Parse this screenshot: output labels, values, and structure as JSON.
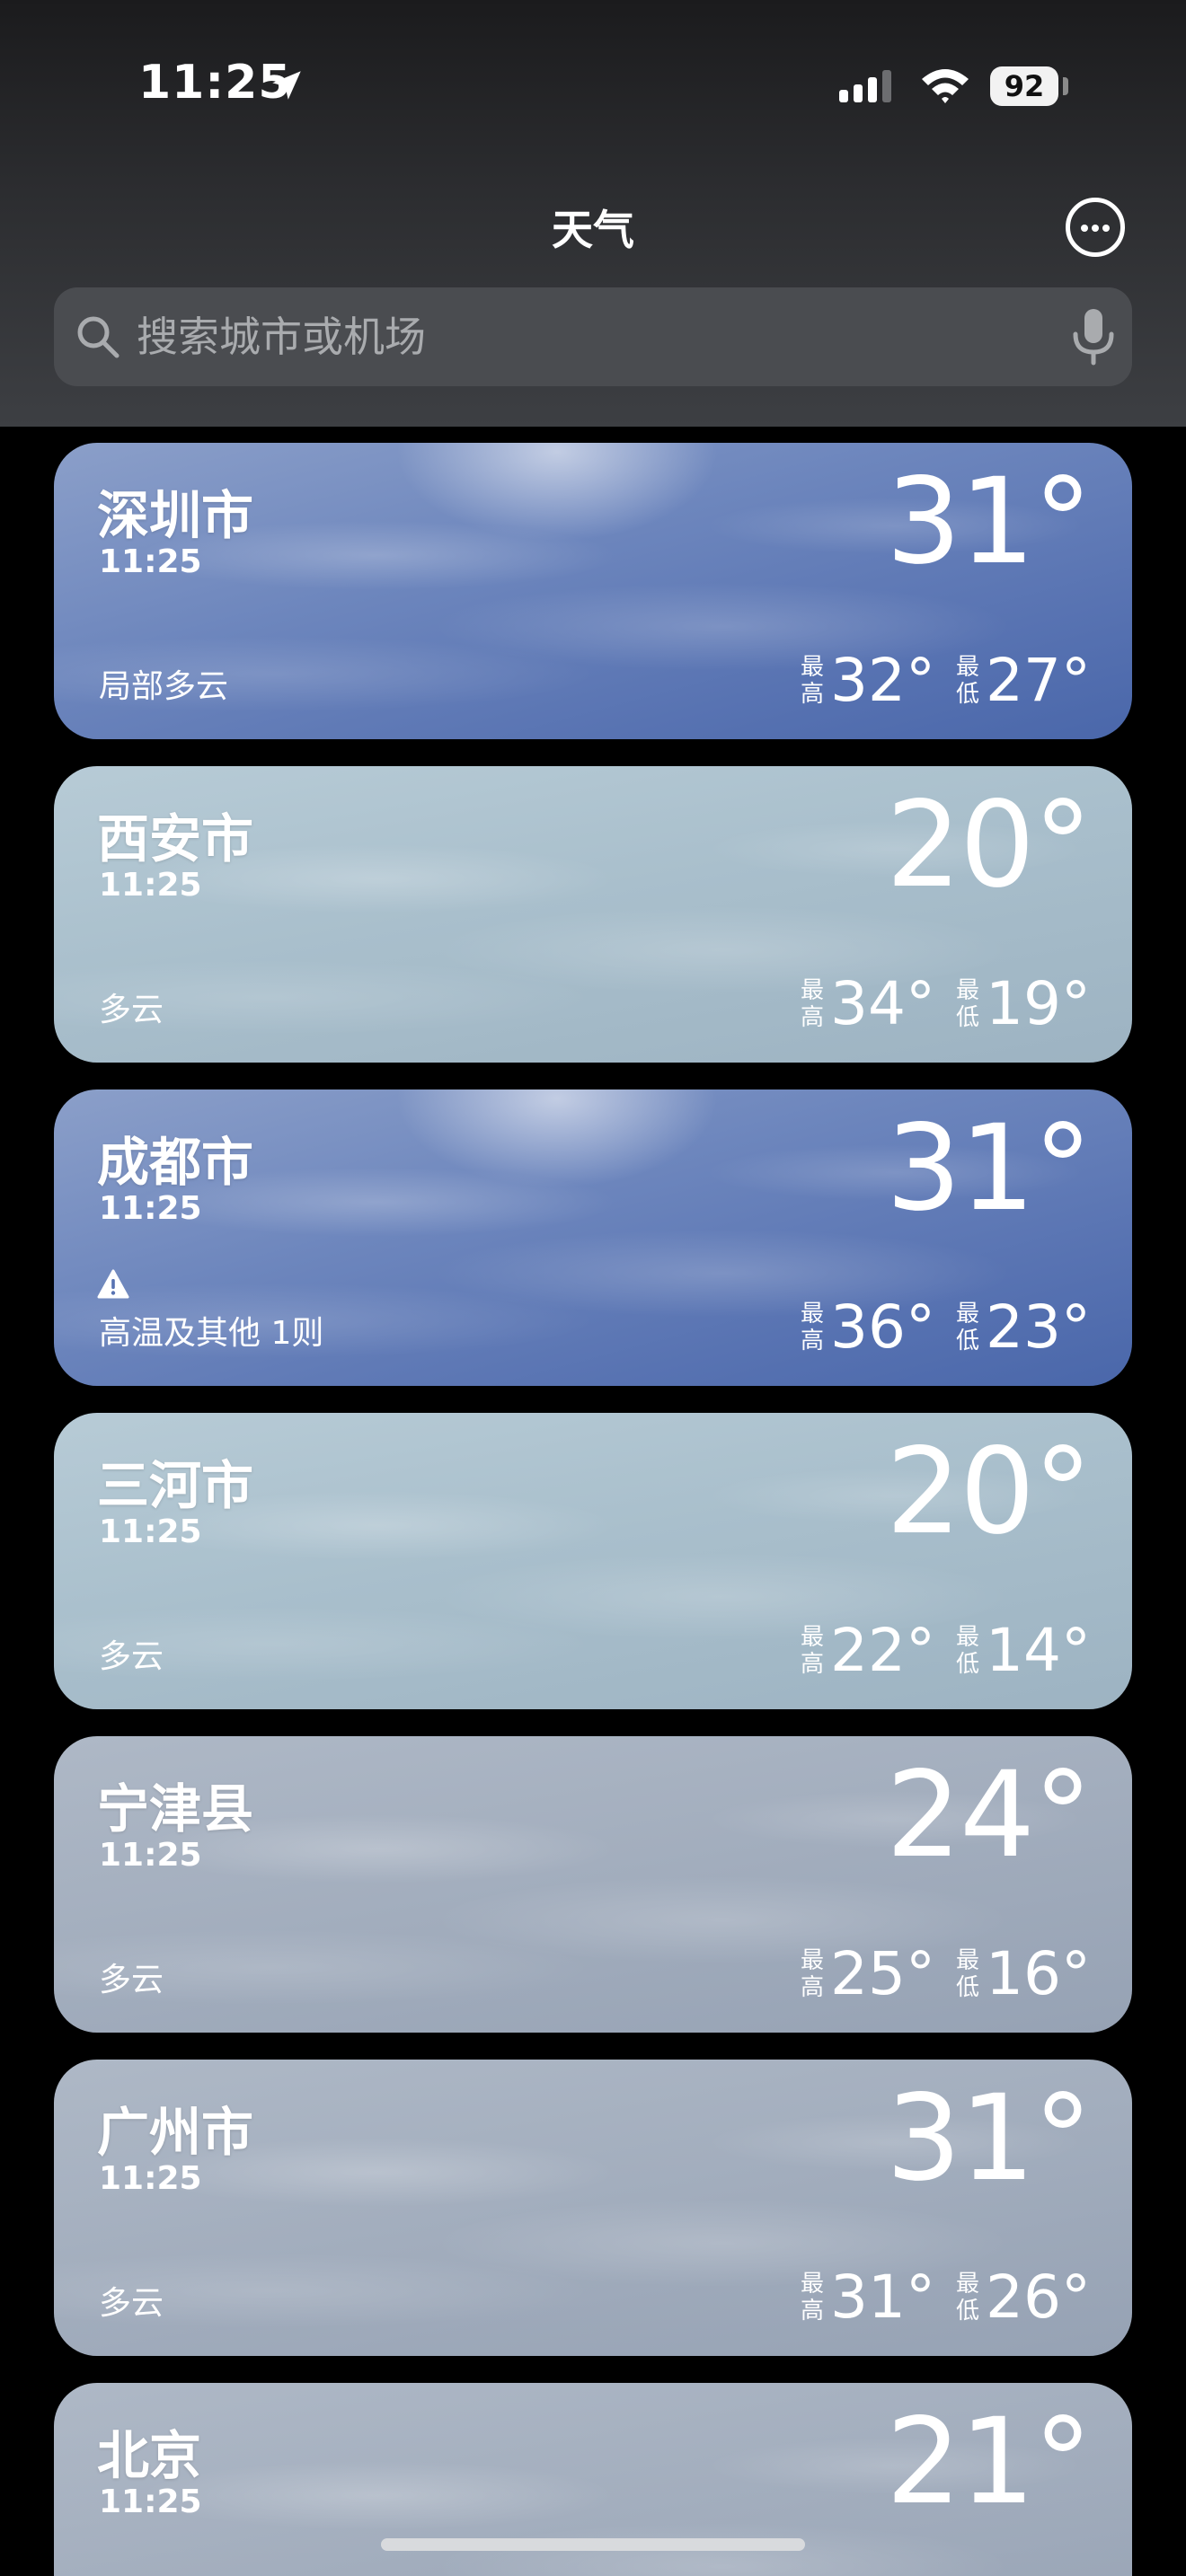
{
  "status_bar": {
    "time": "11:25",
    "battery": "92"
  },
  "nav": {
    "title": "天气",
    "more_icon": "ellipsis-circle-icon"
  },
  "search": {
    "placeholder": "搜索城市或机场",
    "icons": [
      "search-icon",
      "mic-icon"
    ]
  },
  "labels": {
    "high": "最高",
    "low": "最低"
  },
  "cities": [
    {
      "name": "深圳市",
      "time": "11:25",
      "condition": "局部多云",
      "temp": "31°",
      "high": "32°",
      "low": "27°",
      "style": "blue",
      "warning": false
    },
    {
      "name": "西安市",
      "time": "11:25",
      "condition": "多云",
      "temp": "20°",
      "high": "34°",
      "low": "19°",
      "style": "pale",
      "warning": false
    },
    {
      "name": "成都市",
      "time": "11:25",
      "condition": "高温及其他 1则",
      "temp": "31°",
      "high": "36°",
      "low": "23°",
      "style": "blue",
      "warning": true
    },
    {
      "name": "三河市",
      "time": "11:25",
      "condition": "多云",
      "temp": "20°",
      "high": "22°",
      "low": "14°",
      "style": "pale",
      "warning": false
    },
    {
      "name": "宁津县",
      "time": "11:25",
      "condition": "多云",
      "temp": "24°",
      "high": "25°",
      "low": "16°",
      "style": "gray",
      "warning": false
    },
    {
      "name": "广州市",
      "time": "11:25",
      "condition": "多云",
      "temp": "31°",
      "high": "31°",
      "low": "26°",
      "style": "gray",
      "warning": false
    },
    {
      "name": "北京",
      "time": "11:25",
      "condition": "",
      "temp": "21°",
      "high": "",
      "low": "",
      "style": "gray",
      "warning": false
    }
  ],
  "colors": {
    "blue_card": "#6d86bd",
    "pale_card": "#a9bfcc",
    "gray_card": "#a2adbd"
  }
}
